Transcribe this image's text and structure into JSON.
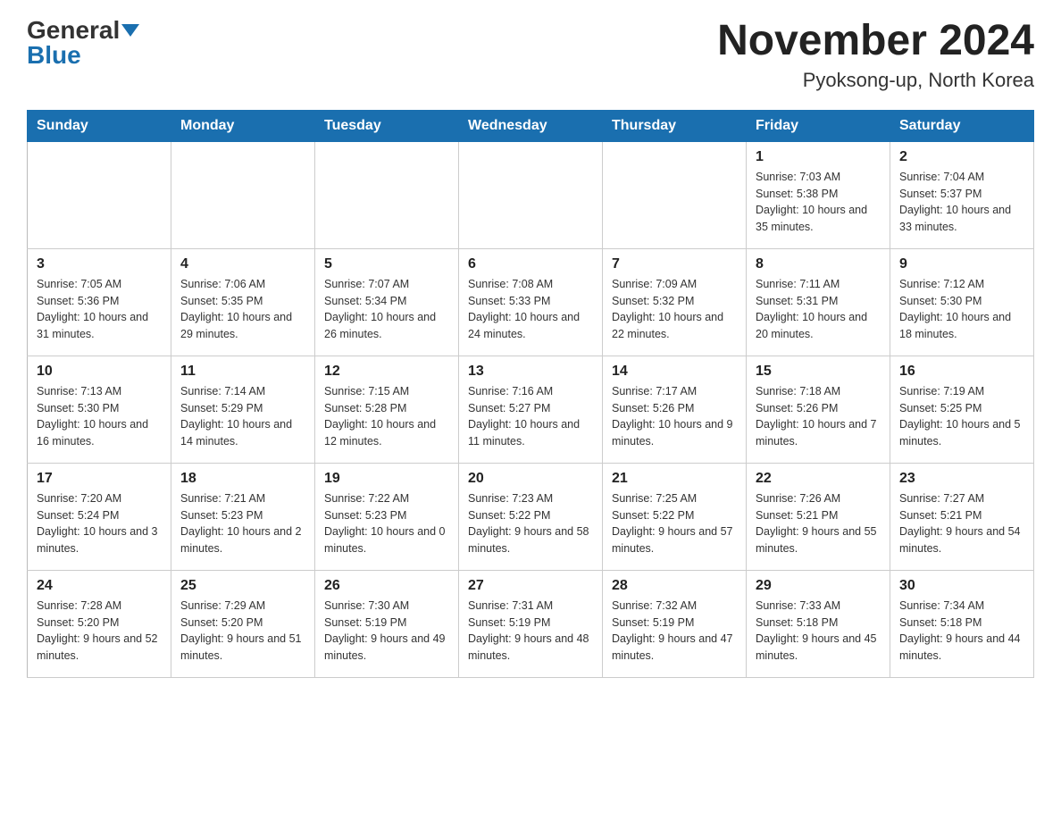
{
  "header": {
    "logo_general": "General",
    "logo_blue": "Blue",
    "month_title": "November 2024",
    "location": "Pyoksong-up, North Korea"
  },
  "weekdays": [
    "Sunday",
    "Monday",
    "Tuesday",
    "Wednesday",
    "Thursday",
    "Friday",
    "Saturday"
  ],
  "weeks": [
    [
      {
        "day": "",
        "info": ""
      },
      {
        "day": "",
        "info": ""
      },
      {
        "day": "",
        "info": ""
      },
      {
        "day": "",
        "info": ""
      },
      {
        "day": "",
        "info": ""
      },
      {
        "day": "1",
        "info": "Sunrise: 7:03 AM\nSunset: 5:38 PM\nDaylight: 10 hours and 35 minutes."
      },
      {
        "day": "2",
        "info": "Sunrise: 7:04 AM\nSunset: 5:37 PM\nDaylight: 10 hours and 33 minutes."
      }
    ],
    [
      {
        "day": "3",
        "info": "Sunrise: 7:05 AM\nSunset: 5:36 PM\nDaylight: 10 hours and 31 minutes."
      },
      {
        "day": "4",
        "info": "Sunrise: 7:06 AM\nSunset: 5:35 PM\nDaylight: 10 hours and 29 minutes."
      },
      {
        "day": "5",
        "info": "Sunrise: 7:07 AM\nSunset: 5:34 PM\nDaylight: 10 hours and 26 minutes."
      },
      {
        "day": "6",
        "info": "Sunrise: 7:08 AM\nSunset: 5:33 PM\nDaylight: 10 hours and 24 minutes."
      },
      {
        "day": "7",
        "info": "Sunrise: 7:09 AM\nSunset: 5:32 PM\nDaylight: 10 hours and 22 minutes."
      },
      {
        "day": "8",
        "info": "Sunrise: 7:11 AM\nSunset: 5:31 PM\nDaylight: 10 hours and 20 minutes."
      },
      {
        "day": "9",
        "info": "Sunrise: 7:12 AM\nSunset: 5:30 PM\nDaylight: 10 hours and 18 minutes."
      }
    ],
    [
      {
        "day": "10",
        "info": "Sunrise: 7:13 AM\nSunset: 5:30 PM\nDaylight: 10 hours and 16 minutes."
      },
      {
        "day": "11",
        "info": "Sunrise: 7:14 AM\nSunset: 5:29 PM\nDaylight: 10 hours and 14 minutes."
      },
      {
        "day": "12",
        "info": "Sunrise: 7:15 AM\nSunset: 5:28 PM\nDaylight: 10 hours and 12 minutes."
      },
      {
        "day": "13",
        "info": "Sunrise: 7:16 AM\nSunset: 5:27 PM\nDaylight: 10 hours and 11 minutes."
      },
      {
        "day": "14",
        "info": "Sunrise: 7:17 AM\nSunset: 5:26 PM\nDaylight: 10 hours and 9 minutes."
      },
      {
        "day": "15",
        "info": "Sunrise: 7:18 AM\nSunset: 5:26 PM\nDaylight: 10 hours and 7 minutes."
      },
      {
        "day": "16",
        "info": "Sunrise: 7:19 AM\nSunset: 5:25 PM\nDaylight: 10 hours and 5 minutes."
      }
    ],
    [
      {
        "day": "17",
        "info": "Sunrise: 7:20 AM\nSunset: 5:24 PM\nDaylight: 10 hours and 3 minutes."
      },
      {
        "day": "18",
        "info": "Sunrise: 7:21 AM\nSunset: 5:23 PM\nDaylight: 10 hours and 2 minutes."
      },
      {
        "day": "19",
        "info": "Sunrise: 7:22 AM\nSunset: 5:23 PM\nDaylight: 10 hours and 0 minutes."
      },
      {
        "day": "20",
        "info": "Sunrise: 7:23 AM\nSunset: 5:22 PM\nDaylight: 9 hours and 58 minutes."
      },
      {
        "day": "21",
        "info": "Sunrise: 7:25 AM\nSunset: 5:22 PM\nDaylight: 9 hours and 57 minutes."
      },
      {
        "day": "22",
        "info": "Sunrise: 7:26 AM\nSunset: 5:21 PM\nDaylight: 9 hours and 55 minutes."
      },
      {
        "day": "23",
        "info": "Sunrise: 7:27 AM\nSunset: 5:21 PM\nDaylight: 9 hours and 54 minutes."
      }
    ],
    [
      {
        "day": "24",
        "info": "Sunrise: 7:28 AM\nSunset: 5:20 PM\nDaylight: 9 hours and 52 minutes."
      },
      {
        "day": "25",
        "info": "Sunrise: 7:29 AM\nSunset: 5:20 PM\nDaylight: 9 hours and 51 minutes."
      },
      {
        "day": "26",
        "info": "Sunrise: 7:30 AM\nSunset: 5:19 PM\nDaylight: 9 hours and 49 minutes."
      },
      {
        "day": "27",
        "info": "Sunrise: 7:31 AM\nSunset: 5:19 PM\nDaylight: 9 hours and 48 minutes."
      },
      {
        "day": "28",
        "info": "Sunrise: 7:32 AM\nSunset: 5:19 PM\nDaylight: 9 hours and 47 minutes."
      },
      {
        "day": "29",
        "info": "Sunrise: 7:33 AM\nSunset: 5:18 PM\nDaylight: 9 hours and 45 minutes."
      },
      {
        "day": "30",
        "info": "Sunrise: 7:34 AM\nSunset: 5:18 PM\nDaylight: 9 hours and 44 minutes."
      }
    ]
  ]
}
